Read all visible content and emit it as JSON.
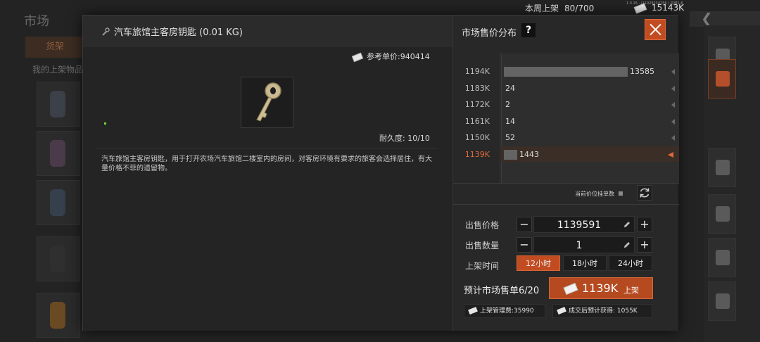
{
  "background": {
    "title": "市场",
    "tab_label": "货架",
    "subtitle": "我的上架物品"
  },
  "top_bar": {
    "weekly_label": "本周上架",
    "weekly_value": "80/700",
    "money": "15143K",
    "version": "1.0.16…|11929234256 | 县城1-6"
  },
  "item": {
    "title": "汽车旅馆主客房钥匙 (0.01 KG)",
    "ref_price": "参考单价:940414",
    "durability": "耐久度: 10/10",
    "description": "汽车旅馆主客房钥匙，用于打开农场汽车旅馆二楼室内的房间，对客房环境有要求的旅客会选择居住，有大量价格不菲的遗留物。"
  },
  "market": {
    "title": "市场售价分布",
    "help": "?",
    "listings_label": "当前价位挂单数",
    "sell_price_label": "出售价格",
    "sell_price": "1139591",
    "sell_qty_label": "出售数量",
    "sell_qty": "1",
    "duration_label": "上架时间",
    "durations": [
      "12小时",
      "18小时",
      "24小时"
    ],
    "selected_duration": "12小时",
    "estimate": "预计市场售单6/20",
    "list_price": "1139K",
    "list_action": "上架",
    "fee": "上架管理费:35990",
    "expected": "成交后预计获得: 1055K"
  },
  "colors": {
    "accent": "#c24c22",
    "highlight_text": "#e06a3a"
  },
  "chart_data": {
    "type": "bar",
    "orientation": "horizontal",
    "categories": [
      "1194K",
      "1183K",
      "1172K",
      "1161K",
      "1150K",
      "1139K"
    ],
    "values": [
      13585,
      24,
      2,
      14,
      52,
      1443
    ],
    "value_labels": [
      "13585",
      "24",
      "2",
      "14",
      "52",
      "1443"
    ],
    "highlighted_category": "1139K",
    "xlim": [
      0,
      13585
    ]
  }
}
